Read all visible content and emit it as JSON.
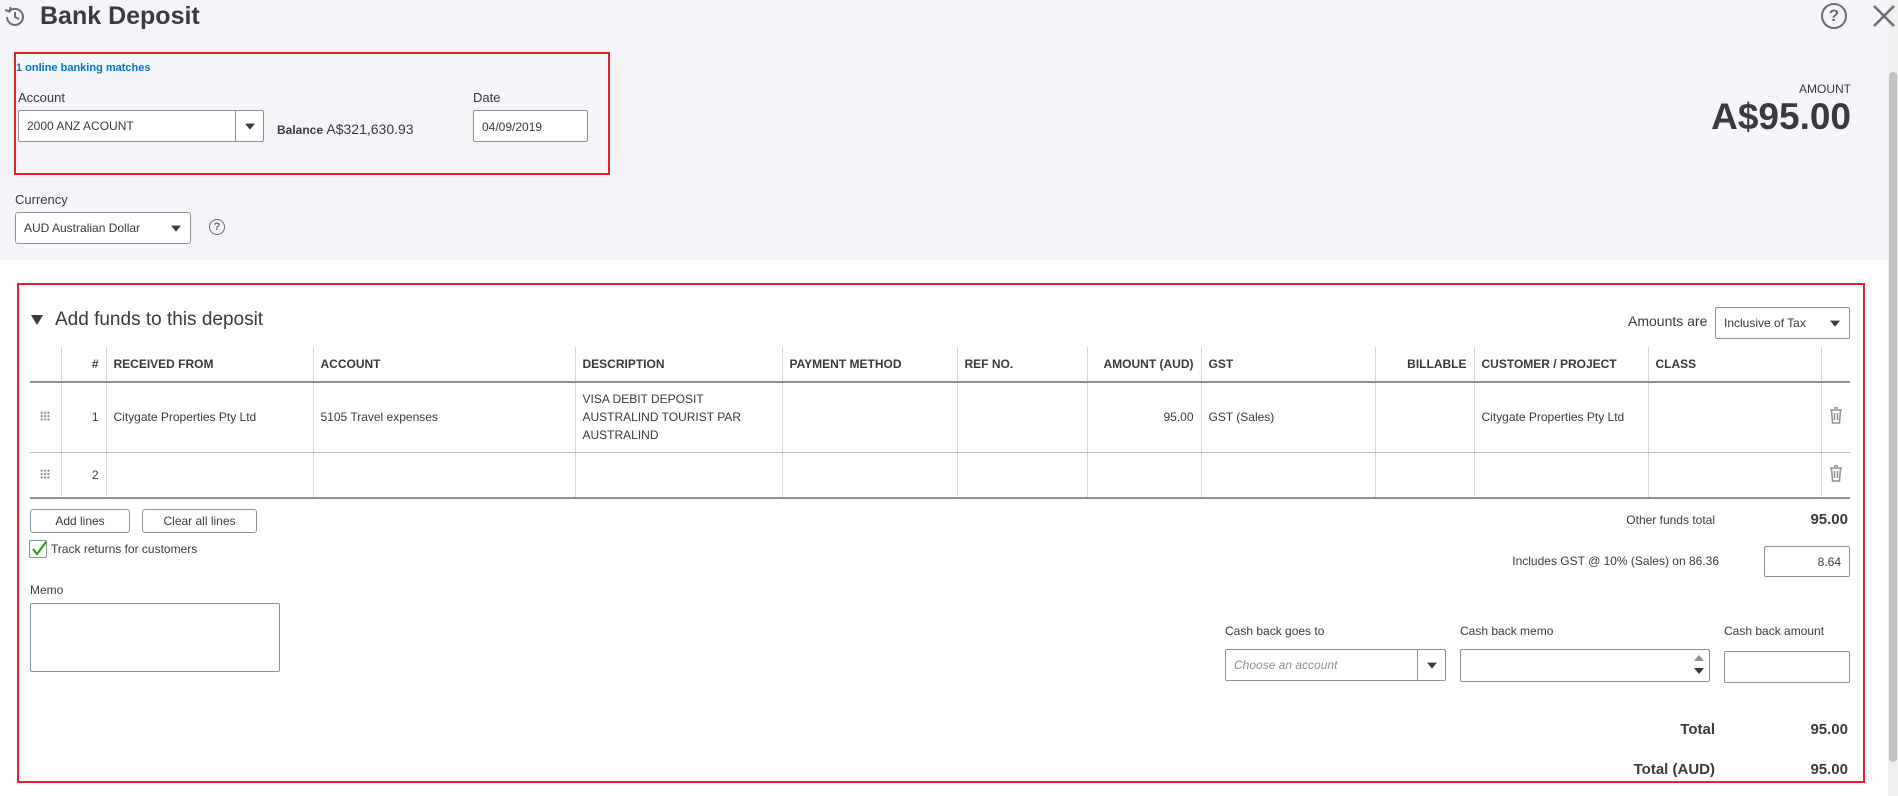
{
  "header": {
    "title": "Bank Deposit",
    "online_matches": "1 online banking matches",
    "account_label": "Account",
    "account_value": "2000 ANZ ACOUNT",
    "balance_label": "Balance",
    "balance_value": "A$321,630.93",
    "date_label": "Date",
    "date_value": "04/09/2019",
    "currency_label": "Currency",
    "currency_value": "AUD Australian Dollar",
    "amount_label": "AMOUNT",
    "amount_value": "A$95.00"
  },
  "section": {
    "title": "Add funds to this deposit",
    "amounts_are_label": "Amounts are",
    "amounts_are_value": "Inclusive of Tax"
  },
  "table": {
    "columns": [
      "#",
      "RECEIVED FROM",
      "ACCOUNT",
      "DESCRIPTION",
      "PAYMENT METHOD",
      "REF NO.",
      "AMOUNT (AUD)",
      "GST",
      "BILLABLE",
      "CUSTOMER / PROJECT",
      "CLASS"
    ],
    "rows": [
      {
        "num": "1",
        "received_from": "Citygate Properties Pty Ltd",
        "account": "5105 Travel expenses",
        "description_lines": [
          "VISA DEBIT DEPOSIT",
          "AUSTRALIND TOURIST PAR",
          "AUSTRALIND"
        ],
        "payment_method": "",
        "ref_no": "",
        "amount": "95.00",
        "gst": "GST (Sales)",
        "billable": "",
        "customer": "Citygate Properties Pty Ltd",
        "class": ""
      },
      {
        "num": "2",
        "received_from": "",
        "account": "",
        "description_lines": [],
        "payment_method": "",
        "ref_no": "",
        "amount": "",
        "gst": "",
        "billable": "",
        "customer": "",
        "class": ""
      }
    ]
  },
  "actions": {
    "add_lines": "Add lines",
    "clear_all_lines": "Clear all lines",
    "track_returns": "Track returns for customers",
    "track_returns_checked": true
  },
  "memo": {
    "label": "Memo",
    "value": ""
  },
  "totals": {
    "other_funds_label": "Other funds total",
    "other_funds_value": "95.00",
    "gst_label": "Includes GST @ 10% (Sales) on 86.36",
    "gst_value": "8.64",
    "total_label": "Total",
    "total_value": "95.00",
    "total_aud_label": "Total (AUD)",
    "total_aud_value": "95.00"
  },
  "cashback": {
    "goes_to_label": "Cash back goes to",
    "goes_to_placeholder": "Choose an account",
    "memo_label": "Cash back memo",
    "amount_label": "Cash back amount"
  },
  "colors": {
    "highlight_box": "#e0242f",
    "link": "#0077c5",
    "checkmark": "#2ca01c",
    "header_bg": "#f4f5f8"
  }
}
